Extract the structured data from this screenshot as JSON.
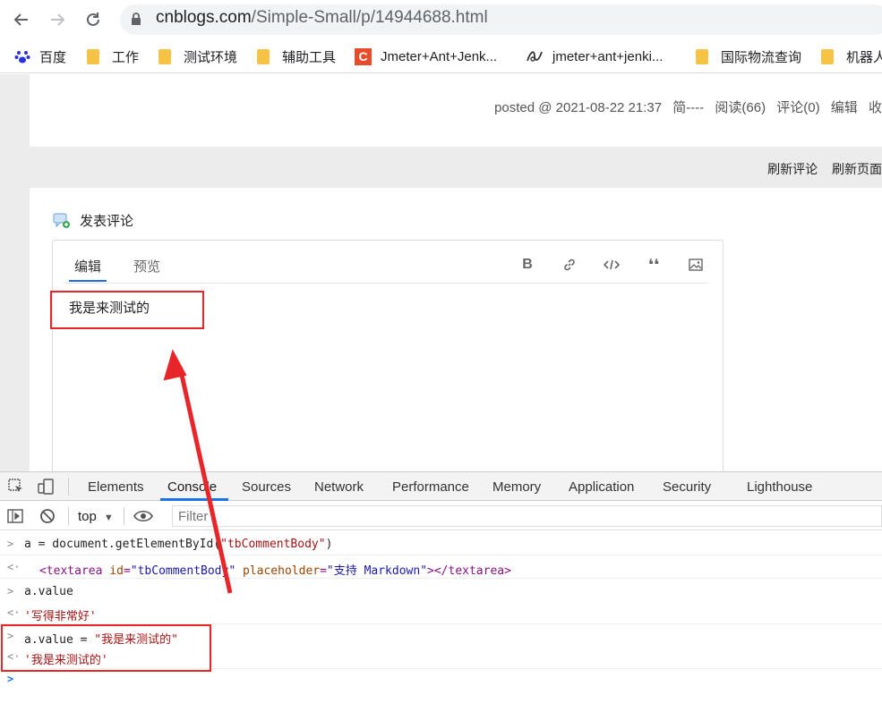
{
  "browser": {
    "url_host": "cnblogs.com",
    "url_path": "/Simple-Small/p/14944688.html",
    "bookmarks": [
      {
        "label": "百度",
        "icon": "baidu-paw-icon"
      },
      {
        "label": "工作",
        "icon": "folder-icon"
      },
      {
        "label": "测试环境",
        "icon": "folder-icon"
      },
      {
        "label": "辅助工具",
        "icon": "folder-icon"
      },
      {
        "label": "Jmeter+Ant+Jenk...",
        "icon": "csdn-logo-icon"
      },
      {
        "label": "jmeter+ant+jenki...",
        "icon": "script-logo-icon"
      },
      {
        "label": "国际物流查询",
        "icon": "folder-icon"
      },
      {
        "label": "机器人",
        "icon": "folder-icon"
      }
    ]
  },
  "post": {
    "meta": {
      "posted": "posted @ 2021-08-22 21:37",
      "author": "简----",
      "reads": "阅读(66)",
      "comments": "评论(0)",
      "edit": "编辑",
      "more": "收"
    },
    "refresh_comments": "刷新评论",
    "refresh_page": "刷新页面"
  },
  "comment": {
    "title": "发表评论",
    "tab_edit": "编辑",
    "tab_preview": "预览",
    "text": "我是来测试的"
  },
  "devtools": {
    "tabs": [
      "Elements",
      "Console",
      "Sources",
      "Network",
      "Performance",
      "Memory",
      "Application",
      "Security",
      "Lighthouse"
    ],
    "active_tab": "Console",
    "context": "top",
    "filter_placeholder": "Filter",
    "console": {
      "l1_code_a": "a = document.getElementById(",
      "l1_str": "\"tbCommentBody\"",
      "l1_close": ")",
      "l2_open": "<textarea ",
      "l2_id_attr": "id",
      "l2_eq1": "=",
      "l2_id_val": "\"tbCommentBody\"",
      "l2_ph_attr": "placeholder",
      "l2_eq2": "=",
      "l2_ph_val": "\"支持 Markdown\"",
      "l2_close": "></textarea>",
      "l3": "a.value",
      "l4": "'写得非常好'",
      "l5_code": "a.value = ",
      "l5_str": "\"我是来测试的\"",
      "l6": "'我是来测试的'"
    }
  },
  "colors": {
    "annotation_red": "#e8262a",
    "active_tab_blue": "#1a73e8"
  }
}
